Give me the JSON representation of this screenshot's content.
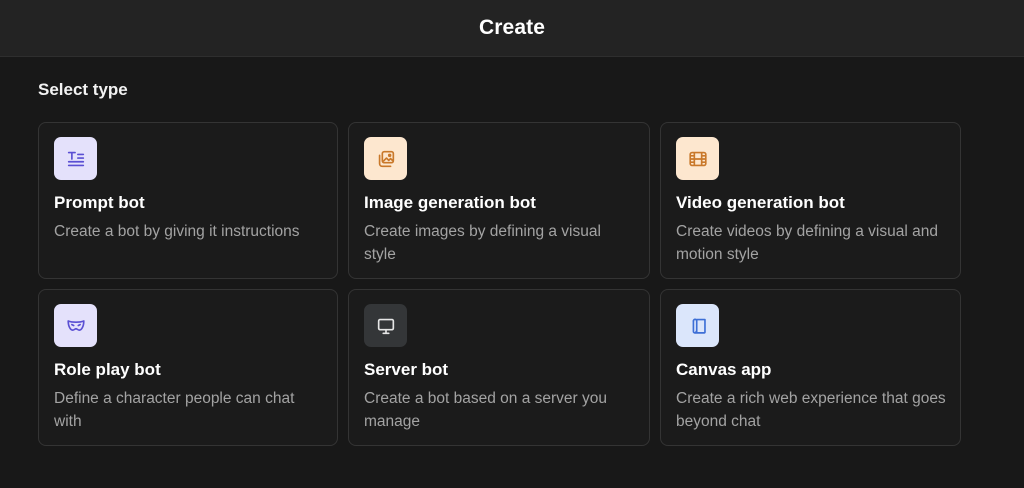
{
  "header": {
    "title": "Create"
  },
  "section": {
    "label": "Select type"
  },
  "cards": [
    {
      "title": "Prompt bot",
      "description": "Create a bot by giving it instructions",
      "icon": "prompt-text-icon",
      "icon_bg": "#e4e1fb",
      "icon_color": "#5a4fd3"
    },
    {
      "title": "Image generation bot",
      "description": "Create images by defining a visual style",
      "icon": "image-gallery-icon",
      "icon_bg": "#fde7cf",
      "icon_color": "#c9782a"
    },
    {
      "title": "Video generation bot",
      "description": "Create videos by defining a visual and motion style",
      "icon": "film-strip-icon",
      "icon_bg": "#fde7cf",
      "icon_color": "#c9782a"
    },
    {
      "title": "Role play bot",
      "description": "Define a character people can chat with",
      "icon": "mask-icon",
      "icon_bg": "#e4e1fb",
      "icon_color": "#5a4fd3"
    },
    {
      "title": "Server bot",
      "description": "Create a bot based on a server you manage",
      "icon": "monitor-icon",
      "icon_bg": "#343638",
      "icon_color": "#e6e6e6"
    },
    {
      "title": "Canvas app",
      "description": "Create a rich web experience that goes beyond chat",
      "icon": "canvas-scroll-icon",
      "icon_bg": "#dbe6fb",
      "icon_color": "#3d6fd6"
    }
  ]
}
